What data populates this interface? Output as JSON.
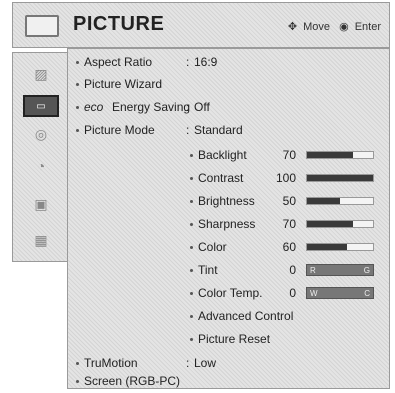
{
  "header": {
    "title": "PICTURE",
    "move_label": "Move",
    "enter_label": "Enter"
  },
  "sidebar": {
    "items": [
      "image-icon",
      "picture-icon",
      "audio-icon",
      "clock-icon",
      "lock-icon",
      "option-icon"
    ]
  },
  "menu": {
    "aspect_ratio": {
      "label": "Aspect Ratio",
      "value": "16:9"
    },
    "picture_wizard": {
      "label": "Picture Wizard"
    },
    "energy_saving": {
      "label": "Energy Saving",
      "prefix": "eco",
      "value": "Off"
    },
    "picture_mode": {
      "label": "Picture Mode",
      "value": "Standard"
    },
    "backlight": {
      "label": "Backlight",
      "value": "70",
      "level": 0.7
    },
    "contrast": {
      "label": "Contrast",
      "value": "100",
      "level": 1.0
    },
    "brightness": {
      "label": "Brightness",
      "value": "50",
      "level": 0.5
    },
    "sharpness": {
      "label": "Sharpness",
      "value": "70",
      "level": 0.7
    },
    "color": {
      "label": "Color",
      "value": "60",
      "level": 0.6
    },
    "tint": {
      "label": "Tint",
      "value": "0",
      "left": "R",
      "right": "G"
    },
    "color_temp": {
      "label": "Color Temp.",
      "value": "0",
      "left": "W",
      "right": "C"
    },
    "advanced_control": {
      "label": "Advanced Control"
    },
    "picture_reset": {
      "label": "Picture Reset"
    },
    "trumotion": {
      "label": "TruMotion",
      "value": "Low"
    },
    "screen": {
      "label": "Screen (RGB-PC)"
    }
  }
}
